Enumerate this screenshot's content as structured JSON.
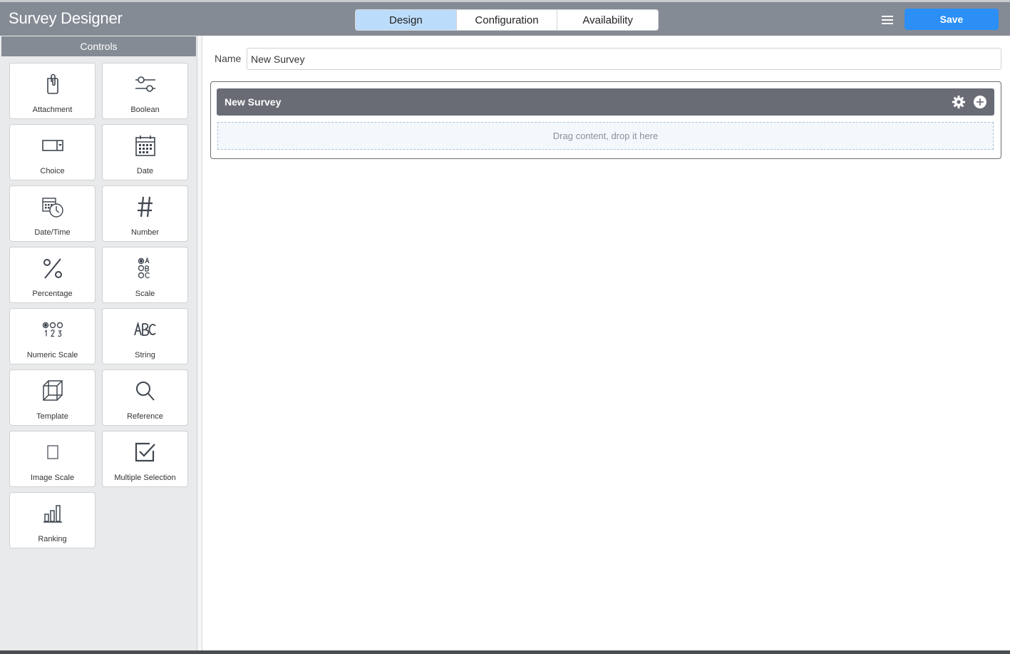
{
  "header": {
    "title": "Survey Designer",
    "tabs": [
      {
        "label": "Design",
        "active": true
      },
      {
        "label": "Configuration",
        "active": false
      },
      {
        "label": "Availability",
        "active": false
      }
    ],
    "menu_icon": "hamburger-menu-icon",
    "save_label": "Save"
  },
  "sidebar": {
    "title": "Controls",
    "controls": [
      {
        "label": "Attachment",
        "icon": "paperclip-icon"
      },
      {
        "label": "Boolean",
        "icon": "toggle-sliders-icon"
      },
      {
        "label": "Choice",
        "icon": "dropdown-icon"
      },
      {
        "label": "Date",
        "icon": "calendar-icon"
      },
      {
        "label": "Date/Time",
        "icon": "calendar-clock-icon"
      },
      {
        "label": "Number",
        "icon": "hash-icon"
      },
      {
        "label": "Percentage",
        "icon": "percent-icon"
      },
      {
        "label": "Scale",
        "icon": "radio-abc-icon"
      },
      {
        "label": "Numeric Scale",
        "icon": "radio-123-icon"
      },
      {
        "label": "String",
        "icon": "abc-text-icon"
      },
      {
        "label": "Template",
        "icon": "cube-icon"
      },
      {
        "label": "Reference",
        "icon": "magnifier-icon"
      },
      {
        "label": "Image Scale",
        "icon": "image-placeholder-icon"
      },
      {
        "label": "Multiple Selection",
        "icon": "checkbox-icon"
      },
      {
        "label": "Ranking",
        "icon": "bar-chart-icon"
      }
    ]
  },
  "main": {
    "name_label": "Name",
    "name_value": "New Survey",
    "survey": {
      "title": "New Survey",
      "settings_icon": "gear-icon",
      "add_icon": "plus-circle-icon",
      "drop_hint": "Drag content, drop it here"
    }
  },
  "colors": {
    "header_bg": "#858b94",
    "active_tab": "#bcdcfb",
    "save_button": "#2b8ff5",
    "survey_header": "#696b75",
    "sidebar_bg": "#e9eaeb"
  }
}
